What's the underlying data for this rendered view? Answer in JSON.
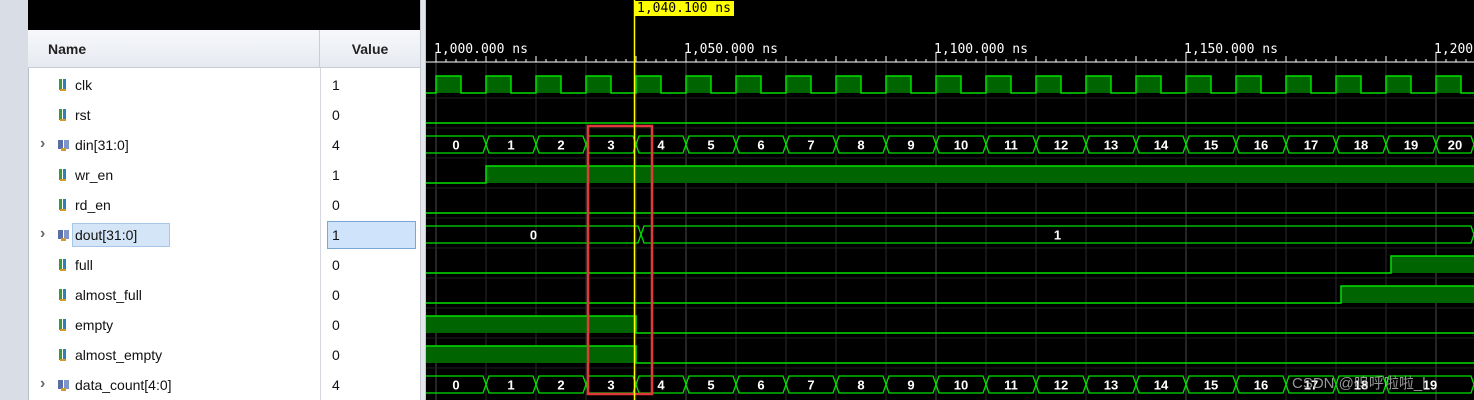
{
  "header": {
    "name": "Name",
    "value": "Value"
  },
  "signals": [
    {
      "name": "clk",
      "value": "1",
      "type": "bit",
      "expandable": false
    },
    {
      "name": "rst",
      "value": "0",
      "type": "bit",
      "expandable": false
    },
    {
      "name": "din[31:0]",
      "value": "4",
      "type": "bus",
      "expandable": true
    },
    {
      "name": "wr_en",
      "value": "1",
      "type": "bit",
      "expandable": false
    },
    {
      "name": "rd_en",
      "value": "0",
      "type": "bit",
      "expandable": false
    },
    {
      "name": "dout[31:0]",
      "value": "1",
      "type": "bus",
      "expandable": true,
      "selected": true
    },
    {
      "name": "full",
      "value": "0",
      "type": "bit",
      "expandable": false
    },
    {
      "name": "almost_full",
      "value": "0",
      "type": "bit",
      "expandable": false
    },
    {
      "name": "empty",
      "value": "0",
      "type": "bit",
      "expandable": false
    },
    {
      "name": "almost_empty",
      "value": "0",
      "type": "bit",
      "expandable": false
    },
    {
      "name": "data_count[4:0]",
      "value": "4",
      "type": "bus",
      "expandable": true
    }
  ],
  "timeline": {
    "cursor_label": "1,040.100 ns",
    "tick_labels": [
      "1,000.000 ns",
      "1,050.000 ns",
      "1,100.000 ns",
      "1,150.000 ns",
      "1,200"
    ]
  },
  "bus_values": {
    "din": [
      "0",
      "1",
      "2",
      "3",
      "4",
      "5",
      "6",
      "7",
      "8",
      "9",
      "10",
      "11",
      "12",
      "13",
      "14",
      "15",
      "16",
      "17",
      "18",
      "19",
      "20"
    ],
    "dout": [
      "0",
      "1"
    ],
    "data_count": [
      "0",
      "1",
      "2",
      "3",
      "4",
      "5",
      "6",
      "7",
      "8",
      "9",
      "10",
      "11",
      "12",
      "13",
      "14",
      "15",
      "16",
      "17",
      "18",
      "19"
    ]
  },
  "colors": {
    "wave": "#00e000",
    "fill": "#006400",
    "cursor": "#ffff00",
    "highlight": "#e03a3a"
  },
  "watermark": "CSDN @呜呼啦啦_l"
}
